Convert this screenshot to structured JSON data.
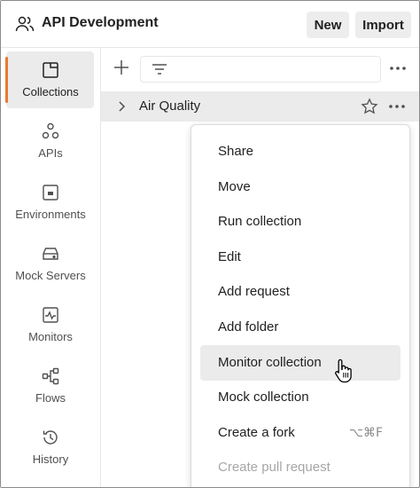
{
  "header": {
    "workspace_title": "API Development",
    "new_label": "New",
    "import_label": "Import"
  },
  "sidebar": {
    "items": [
      {
        "label": "Collections",
        "icon": "collections-icon",
        "active": true
      },
      {
        "label": "APIs",
        "icon": "apis-icon"
      },
      {
        "label": "Environments",
        "icon": "environments-icon"
      },
      {
        "label": "Mock Servers",
        "icon": "mock-servers-icon"
      },
      {
        "label": "Monitors",
        "icon": "monitors-icon"
      },
      {
        "label": "Flows",
        "icon": "flows-icon"
      },
      {
        "label": "History",
        "icon": "history-icon"
      }
    ]
  },
  "collections": [
    {
      "name": "Air Quality"
    }
  ],
  "context_menu": {
    "items": [
      {
        "label": "Share"
      },
      {
        "label": "Move"
      },
      {
        "label": "Run collection"
      },
      {
        "label": "Edit"
      },
      {
        "label": "Add request"
      },
      {
        "label": "Add folder"
      },
      {
        "label": "Monitor collection",
        "hovered": true
      },
      {
        "label": "Mock collection"
      },
      {
        "label": "Create a fork",
        "shortcut": "⌥⌘F"
      },
      {
        "label": "Create pull request",
        "disabled": true
      }
    ]
  },
  "colors": {
    "accent": "#e8792e",
    "selected_bg": "#ebebeb",
    "button_bg": "#ededed"
  }
}
